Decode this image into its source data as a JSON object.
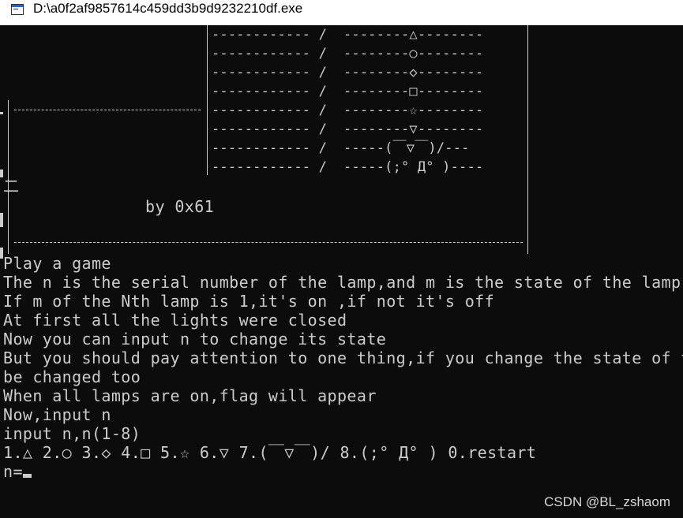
{
  "window": {
    "title": "D:\\a0f2af9857614c459dd3b9d9232210df.exe"
  },
  "banner": {
    "lamp_rows": [
      "------------ /  --------△--------",
      "------------ /  --------○--------",
      "------------ /  --------◇--------",
      "------------ /  --------□--------",
      "------------ /  --------☆--------",
      "------------ /  --------▽--------",
      "------------ /  -----(￣▽￣)/---",
      "------------ /  -----(;° Д° )----"
    ],
    "author": "by 0x61",
    "stray_char": "二"
  },
  "console": {
    "lines": [
      "Play a game",
      "The n is the serial number of the lamp,and m is the state of the lamp",
      "If m of the Nth lamp is 1,it's on ,if not it's off",
      "At first all the lights were closed",
      "Now you can input n to change its state",
      "But you should pay attention to one thing,if you change the state of the",
      "be changed too",
      "When all lamps are on,flag will appear",
      "Now,input n",
      "input n,n(1-8)",
      "1.△ 2.○ 3.◇ 4.□ 5.☆ 6.▽ 7.(￣▽￣)/ 8.(;° Д° ) 0.restart",
      "n="
    ]
  },
  "watermark": "CSDN @BL_zshaom"
}
